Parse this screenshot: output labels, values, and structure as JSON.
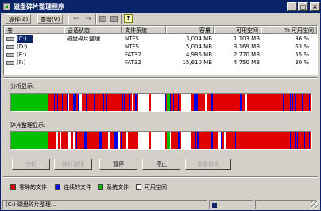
{
  "window": {
    "title": "磁盘碎片整理程序"
  },
  "title_buttons": {
    "minimize": "_",
    "maximize": "□",
    "close": "×"
  },
  "menu": {
    "action": "操作(A)",
    "view": "查看(V)"
  },
  "toolbar": {
    "back": "←",
    "forward": "→",
    "help": "?"
  },
  "table": {
    "headers": [
      "卷",
      "会话状态",
      "文件系统",
      "容量",
      "可用空间",
      "% 可用空间"
    ],
    "rows": [
      {
        "volume": "(C:)",
        "status": "磁盘碎片整理...",
        "fs": "NTFS",
        "capacity": "3,004 MB",
        "free": "1,103 MB",
        "pct": "36 %"
      },
      {
        "volume": "(D:)",
        "status": "",
        "fs": "NTFS",
        "capacity": "5,004 MB",
        "free": "3,169 MB",
        "pct": "63 %"
      },
      {
        "volume": "(E:)",
        "status": "",
        "fs": "FAT32",
        "capacity": "4,986 MB",
        "free": "2,770 MB",
        "pct": "55 %"
      },
      {
        "volume": "(F:)",
        "status": "",
        "fs": "FAT32",
        "capacity": "15,610 MB",
        "free": "4,750 MB",
        "pct": "30 %"
      }
    ]
  },
  "analysis": {
    "label": "分析显示:"
  },
  "defrag": {
    "label": "碎片整理显示:"
  },
  "buttons": {
    "analyze": "分析",
    "defragment": "碎片整理",
    "pause": "暂停",
    "stop": "停止",
    "view_report": "查看报告"
  },
  "legend": [
    {
      "label": "零碎的文件",
      "color": "#e00000"
    },
    {
      "label": "连续的文件",
      "color": "#0000e0"
    },
    {
      "label": "系统文件",
      "color": "#00c000"
    },
    {
      "label": "可用空间",
      "color": "#ffffff"
    }
  ],
  "status": {
    "text": "(C:) 磁盘碎片整理..."
  },
  "colors": {
    "fragmented": "#e00000",
    "contiguous": "#0000e0",
    "system": "#00c000",
    "free": "#ffffff"
  }
}
